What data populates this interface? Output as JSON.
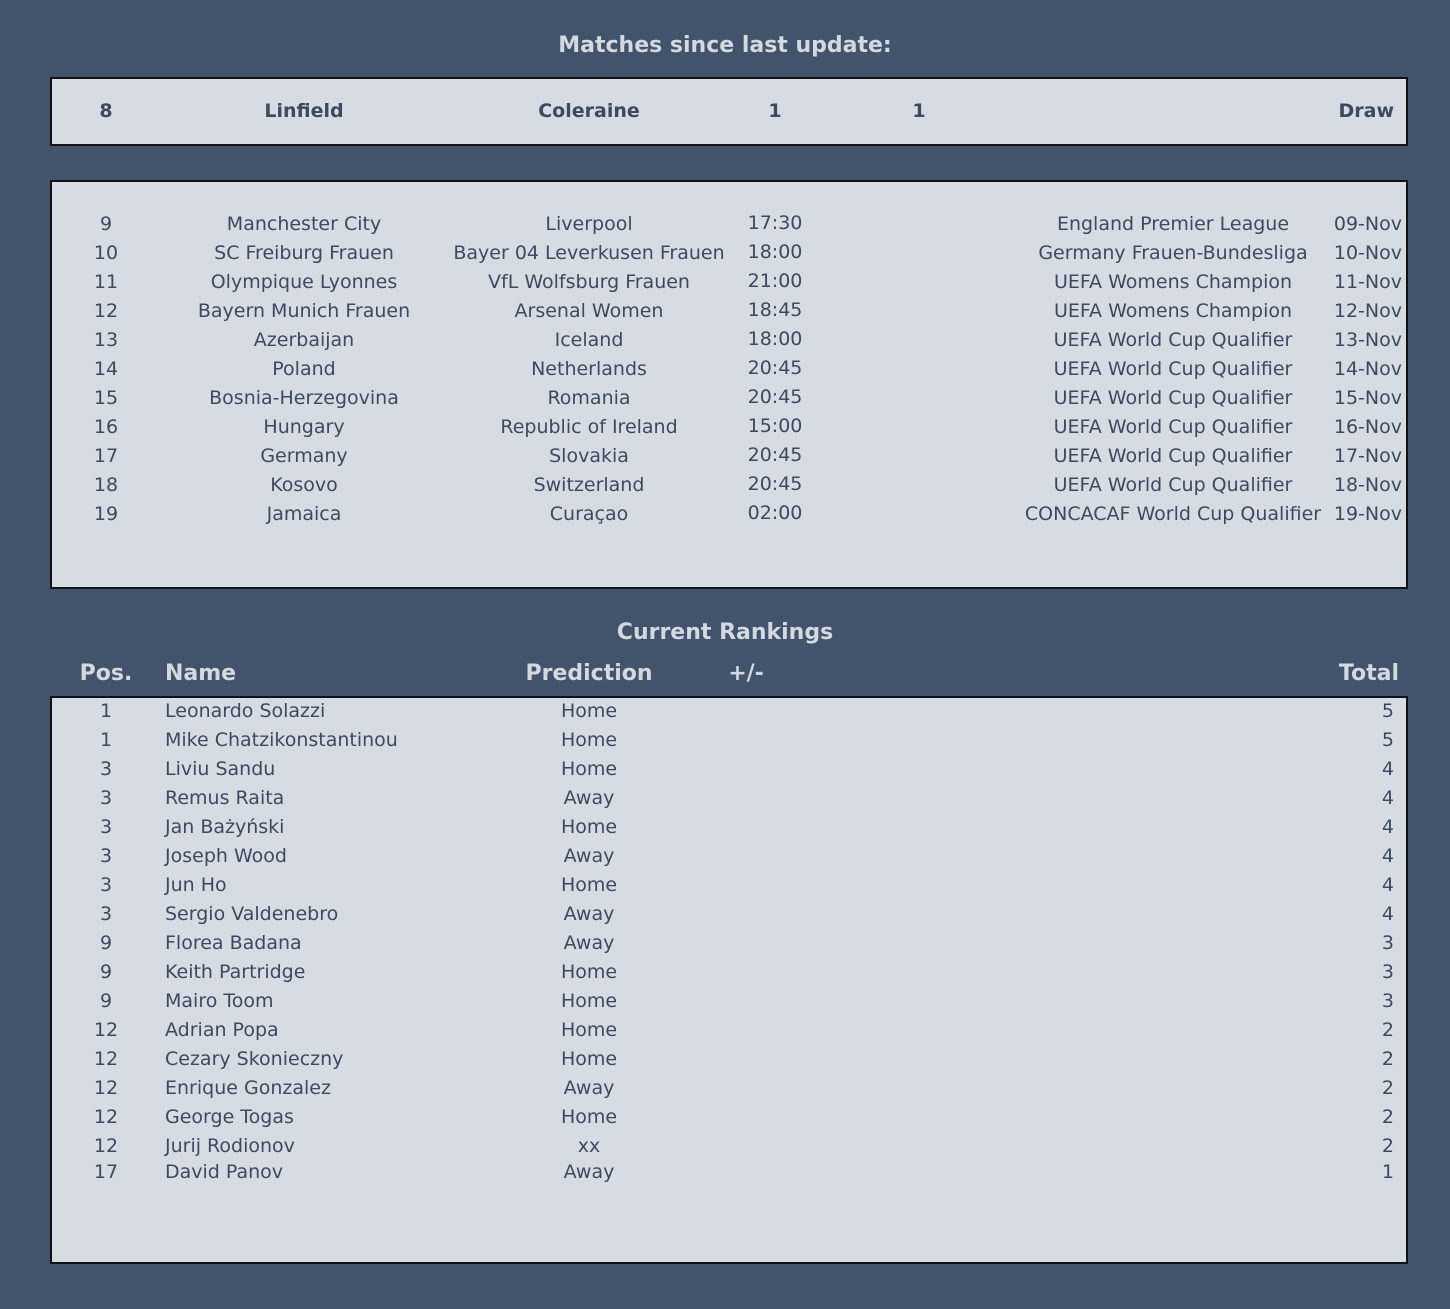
{
  "headings": {
    "last_update": "Matches since last update:",
    "rankings": "Current Rankings"
  },
  "last_match": {
    "num": "8",
    "home": "Linfield",
    "away": "Coleraine",
    "home_score": "1",
    "away_score": "1",
    "result": "Draw"
  },
  "fixtures": [
    {
      "num": "9",
      "home": "Manchester City",
      "away": "Liverpool",
      "time": "17:30",
      "competition": "England Premier League",
      "date": "09-Nov"
    },
    {
      "num": "10",
      "home": "SC Freiburg Frauen",
      "away": "Bayer 04 Leverkusen Frauen",
      "time": "18:00",
      "competition": "Germany Frauen-Bundesliga",
      "date": "10-Nov"
    },
    {
      "num": "11",
      "home": "Olympique Lyonnes",
      "away": "VfL Wolfsburg Frauen",
      "time": "21:00",
      "competition": "UEFA Womens Champion",
      "date": "11-Nov"
    },
    {
      "num": "12",
      "home": "Bayern Munich Frauen",
      "away": "Arsenal Women",
      "time": "18:45",
      "competition": "UEFA Womens Champion",
      "date": "12-Nov"
    },
    {
      "num": "13",
      "home": "Azerbaijan",
      "away": "Iceland",
      "time": "18:00",
      "competition": "UEFA World Cup Qualifier",
      "date": "13-Nov"
    },
    {
      "num": "14",
      "home": "Poland",
      "away": "Netherlands",
      "time": "20:45",
      "competition": "UEFA World Cup Qualifier",
      "date": "14-Nov"
    },
    {
      "num": "15",
      "home": "Bosnia-Herzegovina",
      "away": "Romania",
      "time": "20:45",
      "competition": "UEFA World Cup Qualifier",
      "date": "15-Nov"
    },
    {
      "num": "16",
      "home": "Hungary",
      "away": "Republic of Ireland",
      "time": "15:00",
      "competition": "UEFA World Cup Qualifier",
      "date": "16-Nov"
    },
    {
      "num": "17",
      "home": "Germany",
      "away": "Slovakia",
      "time": "20:45",
      "competition": "UEFA World Cup Qualifier",
      "date": "17-Nov"
    },
    {
      "num": "18",
      "home": "Kosovo",
      "away": "Switzerland",
      "time": "20:45",
      "competition": "UEFA World Cup Qualifier",
      "date": "18-Nov"
    },
    {
      "num": "19",
      "home": "Jamaica",
      "away": "Curaçao",
      "time": "02:00",
      "competition": "CONCACAF World Cup Qualifier",
      "date": "19-Nov"
    }
  ],
  "rankings_headers": {
    "pos": "Pos.",
    "name": "Name",
    "prediction": "Prediction",
    "diff": "+/-",
    "total": "Total"
  },
  "rankings": [
    {
      "pos": "1",
      "name": "Leonardo Solazzi",
      "prediction": "Home",
      "total": "5"
    },
    {
      "pos": "1",
      "name": "Mike Chatzikonstantinou",
      "prediction": "Home",
      "total": "5"
    },
    {
      "pos": "3",
      "name": "Liviu Sandu",
      "prediction": "Home",
      "total": "4"
    },
    {
      "pos": "3",
      "name": "Remus Raita",
      "prediction": "Away",
      "total": "4"
    },
    {
      "pos": "3",
      "name": "Jan Bażyński",
      "prediction": "Home",
      "total": "4"
    },
    {
      "pos": "3",
      "name": "Joseph Wood",
      "prediction": "Away",
      "total": "4"
    },
    {
      "pos": "3",
      "name": "Jun Ho",
      "prediction": "Home",
      "total": "4"
    },
    {
      "pos": "3",
      "name": "Sergio Valdenebro",
      "prediction": "Away",
      "total": "4"
    },
    {
      "pos": "9",
      "name": "Florea Badana",
      "prediction": "Away",
      "total": "3"
    },
    {
      "pos": "9",
      "name": "Keith Partridge",
      "prediction": "Home",
      "total": "3"
    },
    {
      "pos": "9",
      "name": "Mairo Toom",
      "prediction": "Home",
      "total": "3"
    },
    {
      "pos": "12",
      "name": "Adrian Popa",
      "prediction": "Home",
      "total": "2"
    },
    {
      "pos": "12",
      "name": "Cezary Skonieczny",
      "prediction": "Home",
      "total": "2"
    },
    {
      "pos": "12",
      "name": "Enrique Gonzalez",
      "prediction": "Away",
      "total": "2"
    },
    {
      "pos": "12",
      "name": "George Togas",
      "prediction": "Home",
      "total": "2"
    },
    {
      "pos": "12",
      "name": "Jurij Rodionov",
      "prediction": "xx",
      "total": "2"
    },
    {
      "pos": "17",
      "name": "David Panov",
      "prediction": "Away",
      "total": "1"
    }
  ]
}
